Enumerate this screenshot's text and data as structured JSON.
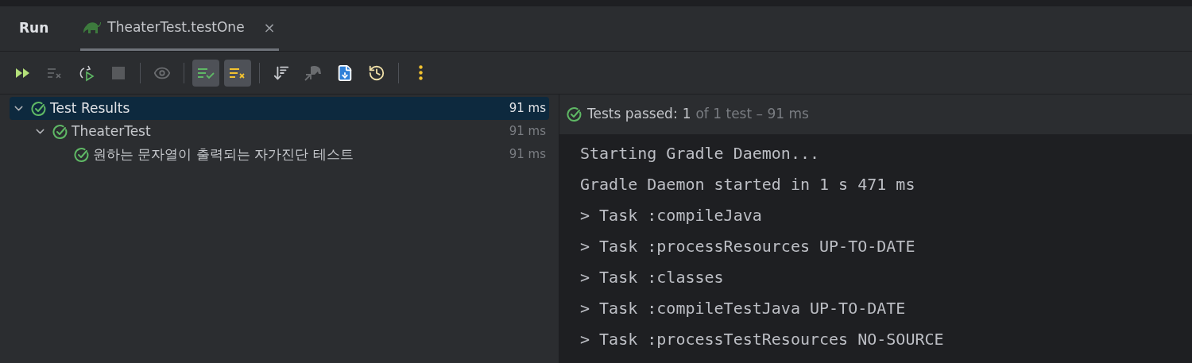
{
  "tabs": [
    {
      "label": "Run",
      "kind": "title"
    },
    {
      "label": "TheaterTest.testOne",
      "kind": "tab",
      "selected": true,
      "close": "×"
    }
  ],
  "toolbar": [
    {
      "kind": "rerun",
      "on": false,
      "disabled": false
    },
    {
      "kind": "rerun-failed",
      "on": false,
      "disabled": true
    },
    {
      "kind": "toggle-auto",
      "on": false,
      "disabled": false
    },
    {
      "kind": "stop",
      "on": false,
      "disabled": true
    },
    {
      "kind": "sep"
    },
    {
      "kind": "eye",
      "on": false,
      "disabled": true
    },
    {
      "kind": "sep"
    },
    {
      "kind": "show-passed",
      "on": true,
      "disabled": false
    },
    {
      "kind": "show-ignored",
      "on": true,
      "disabled": false
    },
    {
      "kind": "sep"
    },
    {
      "kind": "sort",
      "on": false,
      "disabled": false
    },
    {
      "kind": "import",
      "on": false,
      "disabled": true
    },
    {
      "kind": "export",
      "on": false,
      "disabled": false
    },
    {
      "kind": "history",
      "on": false,
      "disabled": false
    },
    {
      "kind": "sep"
    },
    {
      "kind": "more",
      "on": false,
      "disabled": false
    }
  ],
  "tree": [
    {
      "label": "Test Results",
      "time": "91 ms",
      "selected": true,
      "expanded": true,
      "children": [
        {
          "label": "TheaterTest",
          "time": "91 ms",
          "selected": false,
          "expanded": true,
          "children": [
            {
              "label": "원하는 문자열이 출력되는 자가진단 테스트",
              "time": "91 ms",
              "selected": false
            }
          ]
        }
      ]
    }
  ],
  "summary": {
    "label": "Tests passed:",
    "count": "1",
    "rest": "of 1 test – 91 ms"
  },
  "console": [
    "Starting Gradle Daemon...",
    "Gradle Daemon started in 1 s 471 ms",
    "> Task :compileJava",
    "> Task :processResources UP-TO-DATE",
    "> Task :classes",
    "> Task :compileTestJava UP-TO-DATE",
    "> Task :processTestResources NO-SOURCE"
  ]
}
